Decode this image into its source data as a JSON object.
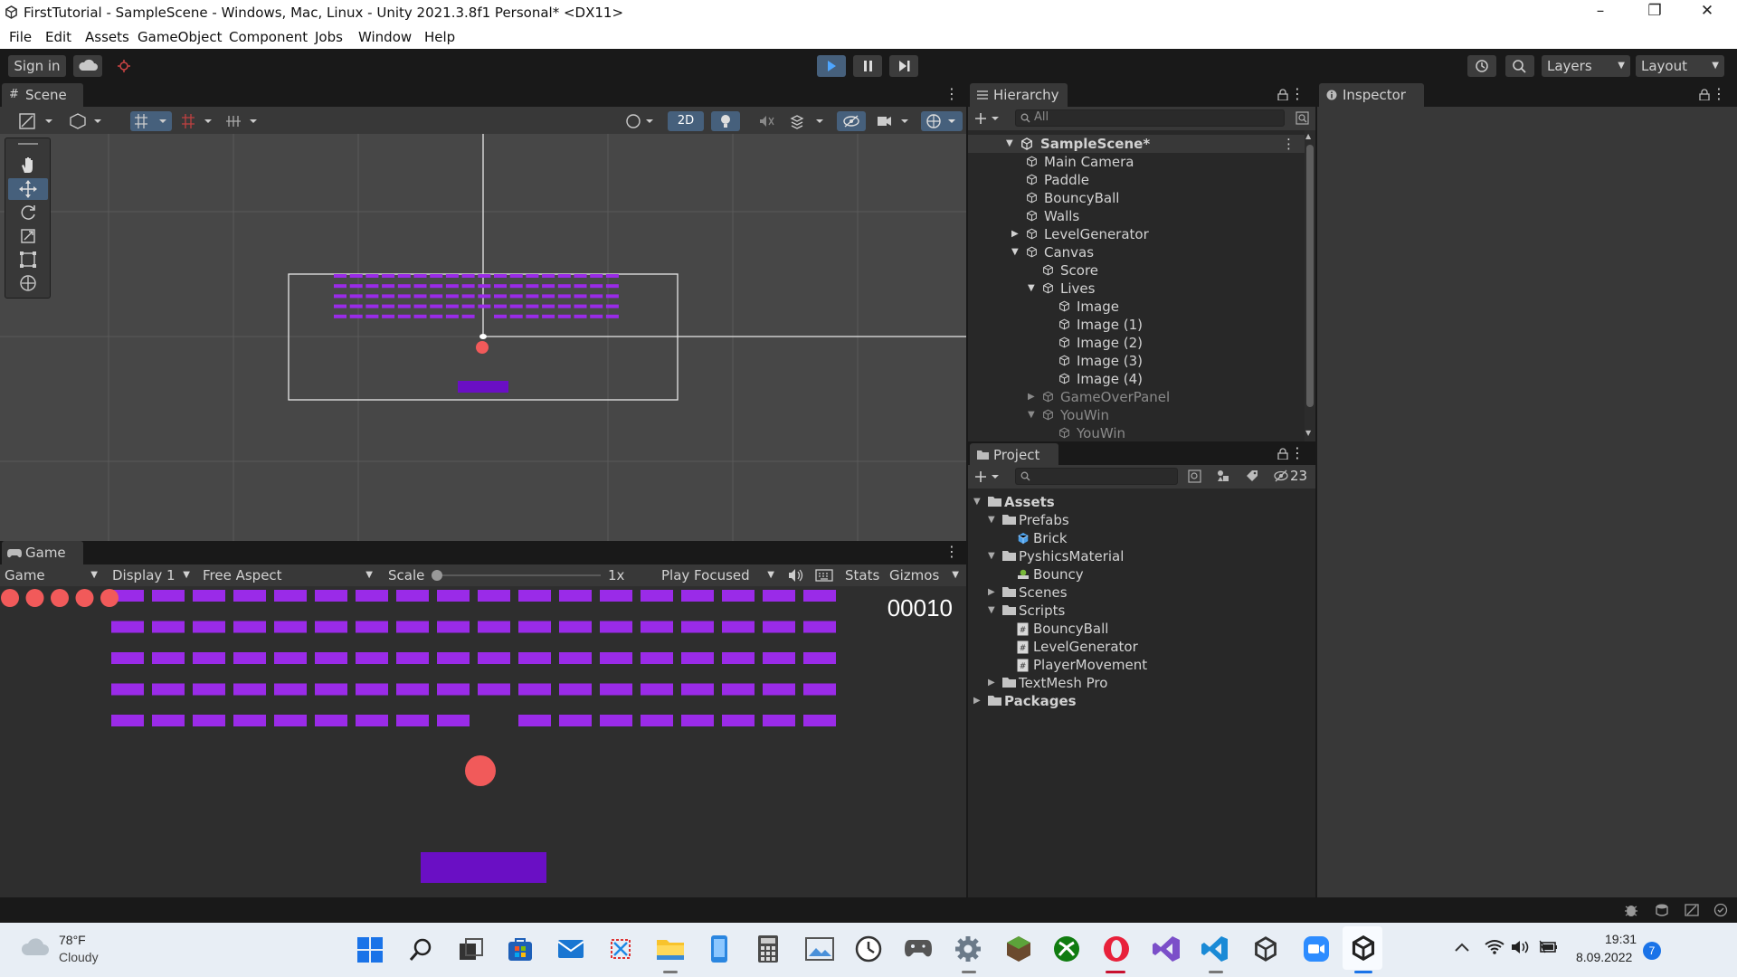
{
  "window": {
    "title": "FirstTutorial - SampleScene - Windows, Mac, Linux - Unity 2021.3.8f1 Personal* <DX11>"
  },
  "menu": [
    "File",
    "Edit",
    "Assets",
    "GameObject",
    "Component",
    "Jobs",
    "Window",
    "Help"
  ],
  "toolbar": {
    "sign_in": "Sign in",
    "layers": "Layers",
    "layout": "Layout"
  },
  "scene": {
    "tab": "Scene",
    "btn_2d": "2D"
  },
  "game": {
    "tab": "Game",
    "mode": "Game",
    "display": "Display 1",
    "aspect": "Free Aspect",
    "scale_label": "Scale",
    "scale_value": "1x",
    "play_focused": "Play Focused",
    "stats": "Stats",
    "gizmos": "Gizmos",
    "score": "00010",
    "lives": 5,
    "rows": 5,
    "cols": 18,
    "missing_brick": {
      "row": 4,
      "col": 9
    }
  },
  "hierarchy": {
    "tab": "Hierarchy",
    "search_placeholder": "All",
    "scene": "SampleScene*",
    "items": [
      {
        "label": "Main Camera",
        "depth": 1,
        "arrow": "",
        "dim": false
      },
      {
        "label": "Paddle",
        "depth": 1,
        "arrow": "",
        "dim": false
      },
      {
        "label": "BouncyBall",
        "depth": 1,
        "arrow": "",
        "dim": false
      },
      {
        "label": "Walls",
        "depth": 1,
        "arrow": "",
        "dim": false
      },
      {
        "label": "LevelGenerator",
        "depth": 1,
        "arrow": "right",
        "dim": false
      },
      {
        "label": "Canvas",
        "depth": 1,
        "arrow": "down",
        "dim": false
      },
      {
        "label": "Score",
        "depth": 2,
        "arrow": "",
        "dim": false
      },
      {
        "label": "Lives",
        "depth": 2,
        "arrow": "down",
        "dim": false
      },
      {
        "label": "Image",
        "depth": 3,
        "arrow": "",
        "dim": false
      },
      {
        "label": "Image (1)",
        "depth": 3,
        "arrow": "",
        "dim": false
      },
      {
        "label": "Image (2)",
        "depth": 3,
        "arrow": "",
        "dim": false
      },
      {
        "label": "Image (3)",
        "depth": 3,
        "arrow": "",
        "dim": false
      },
      {
        "label": "Image (4)",
        "depth": 3,
        "arrow": "",
        "dim": false
      },
      {
        "label": "GameOverPanel",
        "depth": 2,
        "arrow": "right",
        "dim": true
      },
      {
        "label": "YouWin",
        "depth": 2,
        "arrow": "down",
        "dim": true
      },
      {
        "label": "YouWin",
        "depth": 3,
        "arrow": "",
        "dim": true
      }
    ]
  },
  "project": {
    "tab": "Project",
    "hidden_count": "23",
    "items": [
      {
        "label": "Assets",
        "depth": 0,
        "arrow": "down",
        "icon": "folder",
        "bold": true
      },
      {
        "label": "Prefabs",
        "depth": 1,
        "arrow": "down",
        "icon": "folder",
        "bold": false
      },
      {
        "label": "Brick",
        "depth": 2,
        "arrow": "",
        "icon": "prefab",
        "bold": false
      },
      {
        "label": "PyshicsMaterial",
        "depth": 1,
        "arrow": "down",
        "icon": "folder",
        "bold": false
      },
      {
        "label": "Bouncy",
        "depth": 2,
        "arrow": "",
        "icon": "material",
        "bold": false
      },
      {
        "label": "Scenes",
        "depth": 1,
        "arrow": "right",
        "icon": "folder",
        "bold": false
      },
      {
        "label": "Scripts",
        "depth": 1,
        "arrow": "down",
        "icon": "folder",
        "bold": false
      },
      {
        "label": "BouncyBall",
        "depth": 2,
        "arrow": "",
        "icon": "script",
        "bold": false
      },
      {
        "label": "LevelGenerator",
        "depth": 2,
        "arrow": "",
        "icon": "script",
        "bold": false
      },
      {
        "label": "PlayerMovement",
        "depth": 2,
        "arrow": "",
        "icon": "script",
        "bold": false
      },
      {
        "label": "TextMesh Pro",
        "depth": 1,
        "arrow": "right",
        "icon": "folder",
        "bold": false
      },
      {
        "label": "Packages",
        "depth": 0,
        "arrow": "right",
        "icon": "folder",
        "bold": true
      }
    ]
  },
  "inspector": {
    "tab": "Inspector"
  },
  "taskbar": {
    "weather_temp": "78°F",
    "weather_desc": "Cloudy",
    "time": "19:31",
    "date": "8.09.2022",
    "notification_count": "7"
  },
  "colors": {
    "brick": "#9a2be8",
    "ball": "#f15a5a",
    "paddle": "#6a0fc4",
    "accent": "#3a79d8"
  }
}
